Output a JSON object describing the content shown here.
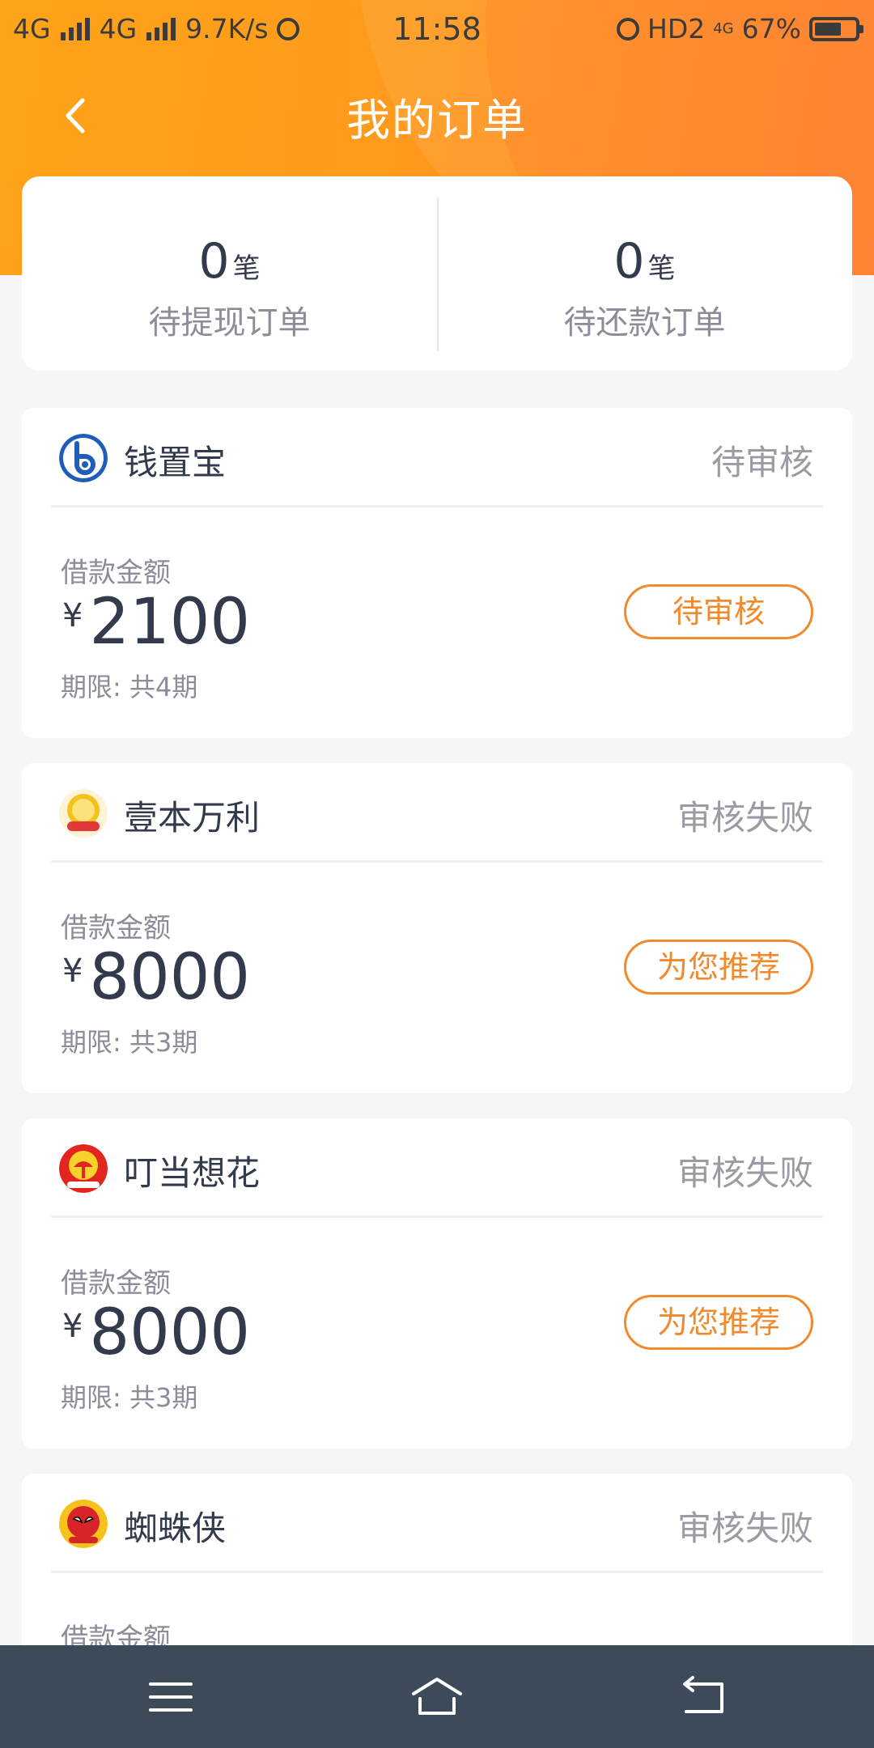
{
  "status_bar": {
    "network_1": "4G",
    "network_2": "4G",
    "speed": "9.7K/s",
    "time": "11:58",
    "hd": "HD2",
    "net_small": "4G",
    "battery": "67%",
    "battery_level": 0.67
  },
  "header": {
    "title": "我的订单",
    "back_icon": "chevron-left-icon"
  },
  "summary": {
    "pending_withdraw": {
      "count": "0",
      "unit": "笔",
      "label": "待提现订单"
    },
    "pending_repay": {
      "count": "0",
      "unit": "笔",
      "label": "待还款订单"
    }
  },
  "orders": [
    {
      "name": "钱置宝",
      "status": "待审核",
      "amount_label": "借款金额",
      "currency": "¥",
      "amount": "2100",
      "term": "期限: 共4期",
      "action": "待审核"
    },
    {
      "name": "壹本万利",
      "status": "审核失败",
      "amount_label": "借款金额",
      "currency": "¥",
      "amount": "8000",
      "term": "期限: 共3期",
      "action": "为您推荐"
    },
    {
      "name": "叮当想花",
      "status": "审核失败",
      "amount_label": "借款金额",
      "currency": "¥",
      "amount": "8000",
      "term": "期限: 共3期",
      "action": "为您推荐"
    },
    {
      "name": "蜘蛛侠",
      "status": "审核失败",
      "amount_label": "借款金额"
    }
  ],
  "nav_bar": {
    "menu_icon": "menu-icon",
    "home_icon": "home-icon",
    "back_icon": "back-icon"
  },
  "colors": {
    "accent": "#f08a2c",
    "header_orange": "#ff9a1c",
    "nav_bg": "#3c4a5a"
  }
}
